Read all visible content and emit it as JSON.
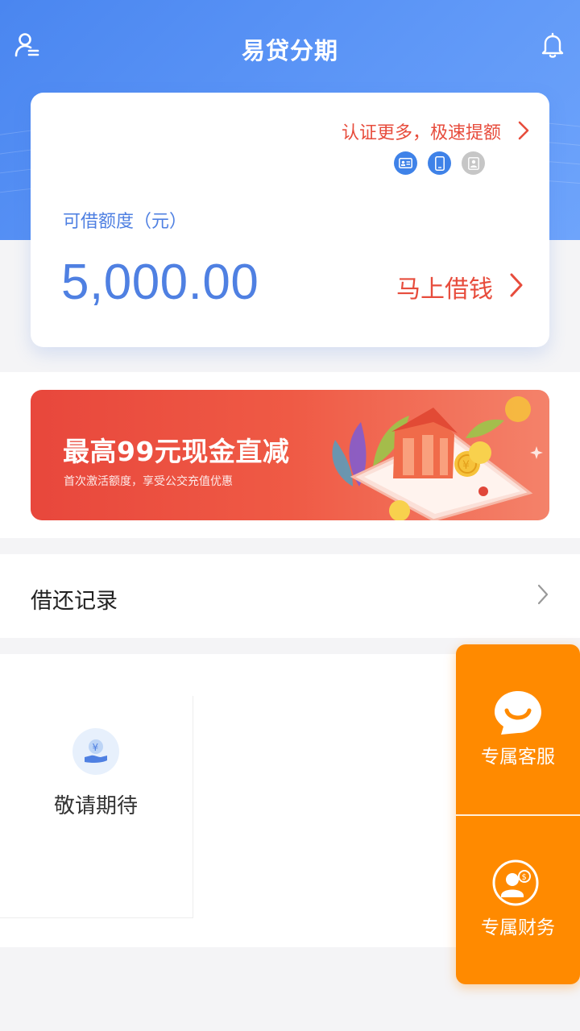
{
  "app": {
    "title": "易贷分期"
  },
  "card": {
    "promo_text": "认证更多，极速提额",
    "limit_label": "可借额度（元）",
    "amount": "5,000.00",
    "borrow_label": "马上借钱",
    "cert_icons": [
      {
        "name": "id-card-icon",
        "verified": true
      },
      {
        "name": "phone-icon",
        "verified": true
      },
      {
        "name": "contact-icon",
        "verified": false
      }
    ]
  },
  "banner": {
    "title": "最高99元现金直减",
    "subtitle": "首次激活额度，享受公交充值优惠"
  },
  "records": {
    "label": "借还记录"
  },
  "services": [
    {
      "label": "敬请期待",
      "icon": "yuan-hand-icon"
    }
  ],
  "float_panel": {
    "customer_service": "专属客服",
    "finance": "专属财务"
  },
  "colors": {
    "primary_blue": "#4f80e2",
    "header_blue": "#5e97f7",
    "accent_red": "#e74c3c",
    "float_orange": "#ff8a00"
  }
}
